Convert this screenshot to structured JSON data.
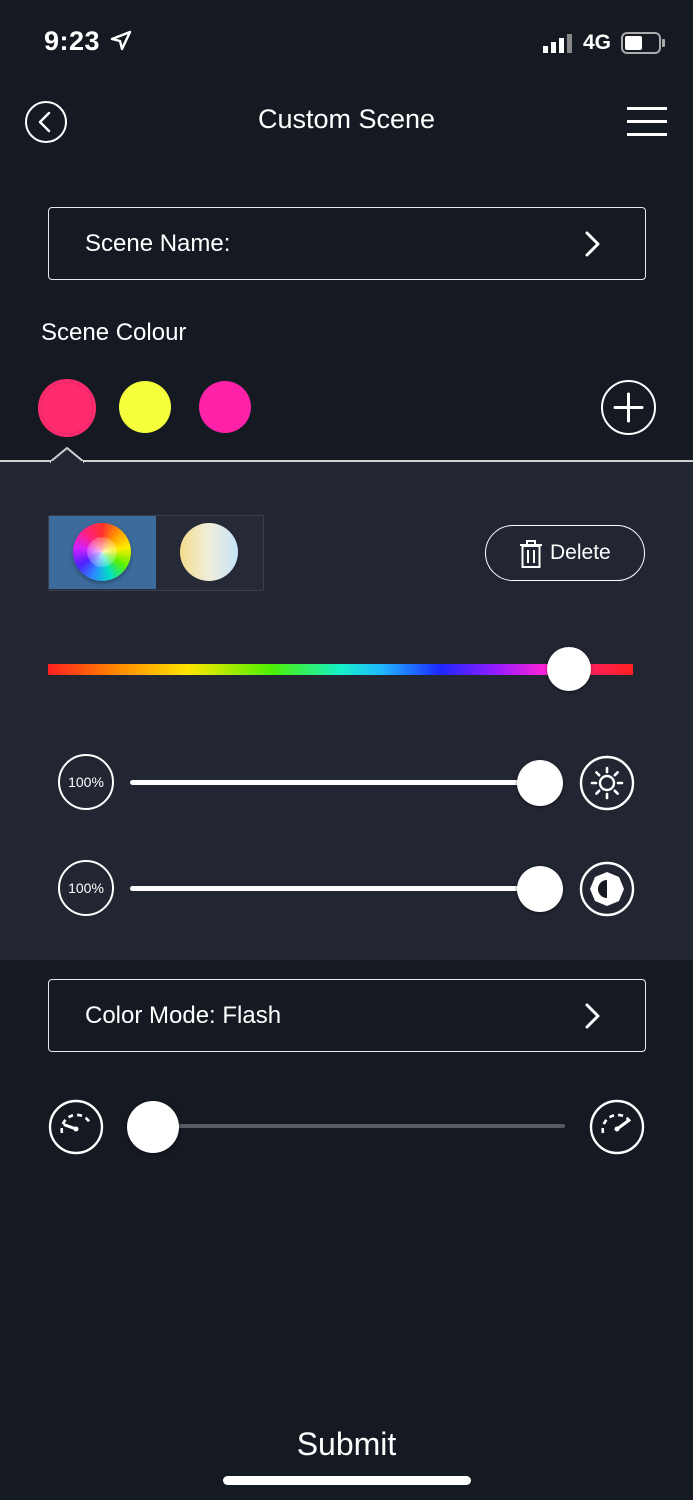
{
  "status_bar": {
    "time": "9:23",
    "network": "4G"
  },
  "header": {
    "title": "Custom Scene"
  },
  "scene_name": {
    "label": "Scene Name:"
  },
  "scene_colour": {
    "label": "Scene Colour",
    "swatches": [
      "#ff2b6e",
      "#f5ff3c",
      "#ff22a8"
    ],
    "selected_index": 0
  },
  "panel": {
    "delete_label": "Delete",
    "hue_value": 0.89,
    "brightness": {
      "label": "100%",
      "value": 1.0
    },
    "saturation": {
      "label": "100%",
      "value": 1.0
    }
  },
  "color_mode": {
    "label": "Color Mode: Flash"
  },
  "speed": {
    "value": 0.0
  },
  "footer": {
    "submit_label": "Submit"
  }
}
